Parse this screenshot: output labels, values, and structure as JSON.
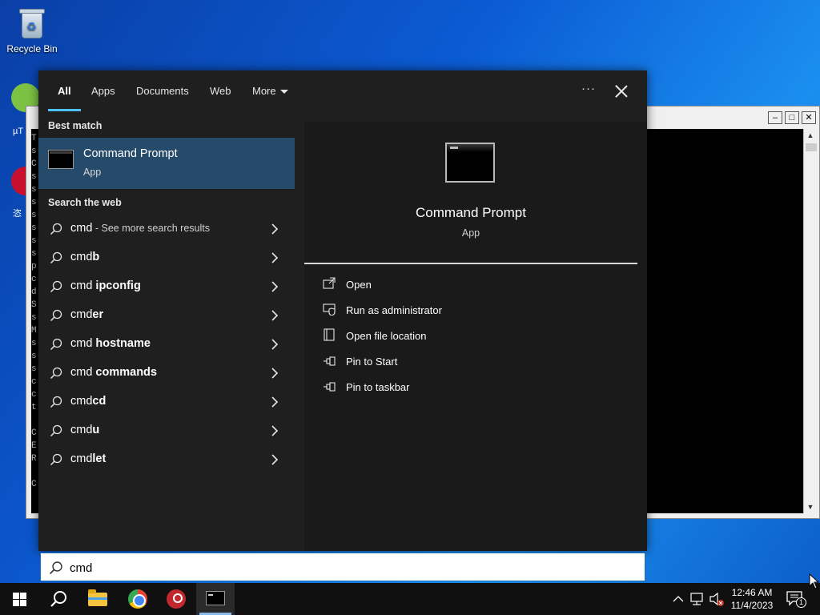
{
  "desktop": {
    "recycle_bin_label": "Recycle Bin",
    "partial_label_1": "µT",
    "partial_label_2": "恣"
  },
  "console_window": {
    "left_edge_chars": [
      "T",
      "s",
      "C",
      "s",
      "s",
      "s",
      "s",
      "s",
      "s",
      "s",
      "p",
      "c",
      "d",
      "S",
      "s",
      "M",
      "s",
      "s",
      "s",
      "c",
      "c",
      "t",
      "",
      "C",
      "E",
      "R",
      "",
      "C"
    ]
  },
  "search": {
    "filters": {
      "all": "All",
      "apps": "Apps",
      "documents": "Documents",
      "web": "Web",
      "more": "More"
    },
    "more_options_label": "···",
    "best_match_heading": "Best match",
    "best_match": {
      "title": "Command Prompt",
      "subtitle": "App"
    },
    "search_web_heading": "Search the web",
    "web_results": [
      {
        "plain": "cmd",
        "bold": "",
        "hint": " - See more search results"
      },
      {
        "plain": "cmd",
        "bold": "b",
        "hint": ""
      },
      {
        "plain": "cmd ",
        "bold": "ipconfig",
        "hint": ""
      },
      {
        "plain": "cmd",
        "bold": "er",
        "hint": ""
      },
      {
        "plain": "cmd ",
        "bold": "hostname",
        "hint": ""
      },
      {
        "plain": "cmd ",
        "bold": "commands",
        "hint": ""
      },
      {
        "plain": "cmd",
        "bold": "cd",
        "hint": ""
      },
      {
        "plain": "cmd",
        "bold": "u",
        "hint": ""
      },
      {
        "plain": "cmd",
        "bold": "let",
        "hint": ""
      }
    ],
    "preview": {
      "title": "Command Prompt",
      "subtitle": "App",
      "actions": [
        {
          "label": "Open",
          "icon": "open-icon"
        },
        {
          "label": "Run as administrator",
          "icon": "shield-icon"
        },
        {
          "label": "Open file location",
          "icon": "file-location-icon"
        },
        {
          "label": "Pin to Start",
          "icon": "pin-icon"
        },
        {
          "label": "Pin to taskbar",
          "icon": "pin-icon"
        }
      ]
    },
    "query": "cmd"
  },
  "taskbar": {
    "clock_time": "12:46 AM",
    "clock_date": "11/4/2023",
    "notification_count": "1"
  },
  "colors": {
    "accent": "#4cc2ff",
    "selected_row": "#264b6a",
    "panel_bg": "#1f1f1f"
  }
}
